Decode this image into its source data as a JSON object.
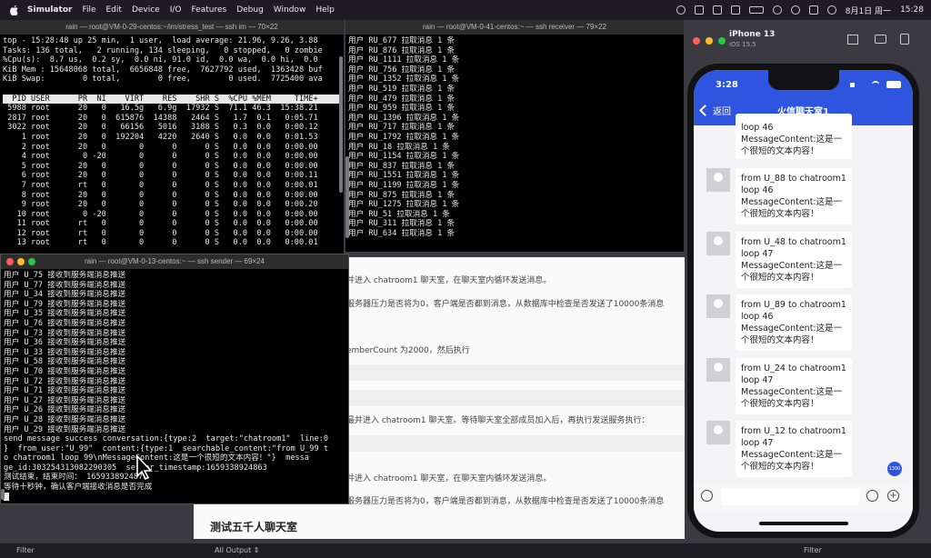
{
  "menubar": {
    "app": "Simulator",
    "items": [
      "File",
      "Edit",
      "Device",
      "I/O",
      "Features",
      "Debug",
      "Window",
      "Help"
    ],
    "date": "8月1日 周一",
    "time": "15:28"
  },
  "sim_window": {
    "title": "iPhone 13",
    "subtitle": "iOS 15.5"
  },
  "terminals": {
    "stress": {
      "title": "rain — root@VM-0-29-centos:~/im/stress_test — ssh im — 70×22",
      "lines": [
        "top - 15:28:48 up 25 min,  1 user,  load average: 21.96, 9.26, 3.88",
        "Tasks: 136 total,   2 running, 134 sleeping,   0 stopped,   0 zombie",
        "%Cpu(s):  8.7 us,  0.2 sy,  0.0 ni, 91.0 id,  0.0 wa,  0.0 hi,  0.0",
        "KiB Mem : 15648068 total,  6656848 free,  7627792 used,  1363428 buf",
        "KiB Swap:        0 total,        0 free,        0 used.  7725400 ava",
        ""
      ],
      "header": "  PID USER      PR  NI    VIRT    RES    SHR S  %CPU %MEM     TIME+",
      "procs": [
        " 5988 root      20   0   16.5g   6.9g  17932 S  71.1 46.3  15:38.21",
        " 2817 root      20   0  615876  14388   2464 S   1.7  0.1   0:05.71",
        " 3022 root      20   0   66156   5016   3188 S   0.3  0.0   0:00.12",
        "    1 root      20   0  192204   4220   2640 S   0.0  0.0   0:01.53",
        "    2 root      20   0       0      0      0 S   0.0  0.0   0:00.00",
        "    4 root       0 -20       0      0      0 S   0.0  0.0   0:00.00",
        "    5 root      20   0       0      0      0 S   0.0  0.0   0:00.00",
        "    6 root      20   0       0      0      0 S   0.0  0.0   0:00.11",
        "    7 root      rt   0       0      0      0 S   0.0  0.0   0:00.01",
        "    8 root      20   0       0      0      0 S   0.0  0.0   0:00.00",
        "    9 root      20   0       0      0      0 S   0.0  0.0   0:00.20",
        "   10 root       0 -20       0      0      0 S   0.0  0.0   0:00.00",
        "   11 root      rt   0       0      0      0 S   0.0  0.0   0:00.00",
        "   12 root      rt   0       0      0      0 S   0.0  0.0   0:00.00",
        "   13 root      rt   0       0      0      0 S   0.0  0.0   0:00.01"
      ]
    },
    "receiver": {
      "title": "rain — root@VM-0-41-centos:~ — ssh receiver — 79×22",
      "lines": [
        "用户 RU_677 拉取消息 1 条",
        "用户 RU_876 拉取消息 1 条",
        "用户 RU_1111 拉取消息 1 条",
        "用户 RU_756 拉取消息 1 条",
        "用户 RU_1352 拉取消息 1 条",
        "用户 RU_519 拉取消息 1 条",
        "用户 RU_479 拉取消息 1 条",
        "用户 RU_959 拉取消息 1 条",
        "用户 RU_1396 拉取消息 1 条",
        "用户 RU_717 拉取消息 1 条",
        "用户 RU_1792 拉取消息 1 条",
        "用户 RU_18 拉取消息 1 条",
        "用户 RU_1154 拉取消息 1 条",
        "用户 RU_837 拉取消息 1 条",
        "用户 RU_1551 拉取消息 1 条",
        "用户 RU_1199 拉取消息 1 条",
        "用户 RU_875 拉取消息 1 条",
        "用户 RU_1275 拉取消息 1 条",
        "用户 RU_51 拉取消息 1 条",
        "用户 RU_311 拉取消息 1 条",
        "用户 RU_634 拉取消息 1 条"
      ]
    },
    "sender": {
      "title": "rain — root@VM-0-13-centos:~ — ssh sender — 69×24",
      "lines": [
        "用户 U_75 接收到服务端消息推送",
        "用户 U_77 接收到服务端消息推送",
        "用户 U_34 接收到服务端消息推送",
        "用户 U_79 接收到服务端消息推送",
        "用户 U_35 接收到服务端消息推送",
        "用户 U_76 接收到服务端消息推送",
        "用户 U_73 接收到服务端消息推送",
        "用户 U_36 接收到服务端消息推送",
        "用户 U_33 接收到服务端消息推送",
        "用户 U_58 接收到服务端消息推送",
        "用户 U_70 接收到服务端消息推送",
        "用户 U_72 接收到服务端消息推送",
        "用户 U_71 接收到服务端消息推送",
        "用户 U_27 接收到服务端消息推送",
        "用户 U_26 接收到服务端消息推送",
        "用户 U_28 接收到服务端消息推送",
        "用户 U_29 接收到服务端消息推送",
        "send message success conversation:{type:2  target:\"chatroom1\"  line:0",
        "}  from_user:\"U_99\"  content:{type:1  searchable_content:\"from U_99 t",
        "o chatroom1 loop 99\\nMessageContent:这是一个很短的文本内容！\"}  messa",
        "ge_id:303254313082290305  server_timestamp:1659338924863",
        "测试结束，结束时间： 1659338924876",
        "等待十秒钟，确认客户端接收消息是否完成"
      ]
    }
  },
  "doc": {
    "lines": [
      "并进入 chatroom1 聊天室，在聊天室内循环发送消息。",
      "服务器压力是否将为0，客户端是否都到消息，从数据库中检查是否发送了10000条消息",
      "emberCount 为2000，然后执行",
      "最并进入 chatroom1 聊天室。等待聊天室全部成员加入后，再执行发送服务执行：",
      "并进入 chatroom1 聊天室，在聊天室内循环发送消息。",
      "服务器压力是否将为0，客户端是否都到消息，从数据库中检查是否发送了10000条消息"
    ],
    "heading": "测试五千人聊天室"
  },
  "statusbar": {
    "filter_left": "Filter",
    "output": "All Output ⇕",
    "filter_right": "Filter"
  },
  "phone": {
    "time": "3:28",
    "back_label": "返回",
    "title": "火信聊天室1",
    "messages": [
      {
        "text": "loop 46\nMessageContent:这是一个很短的文本内容！"
      },
      {
        "text": "from U_88 to chatroom1\nloop 46\nMessageContent:这是一个很短的文本内容！"
      },
      {
        "text": "from U_48 to chatroom1\nloop 47\nMessageContent:这是一个很短的文本内容！"
      },
      {
        "text": "from U_89 to chatroom1\nloop 46\nMessageContent:这是一个很短的文本内容！"
      },
      {
        "text": "from U_24 to chatroom1\nloop 47\nMessageContent:这是一个很短的文本内容！"
      },
      {
        "text": "from U_12 to chatroom1\nloop 47\nMessageContent:这是一个很短的文本内容！"
      }
    ],
    "unread_badge": "1300"
  },
  "colors": {
    "nav": "#2f55e0",
    "terminal_bg": "#000000",
    "menubar": "#1f1a26"
  }
}
